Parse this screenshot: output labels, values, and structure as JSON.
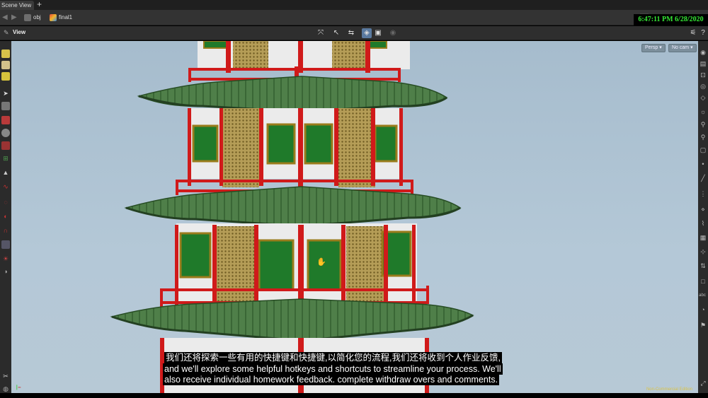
{
  "tabs": {
    "scene_view": "Scene View",
    "add": "+"
  },
  "path": {
    "obj": "obj",
    "node": "final1"
  },
  "timestamp": "6:47:11 PM 6/28/2020",
  "viewbar": {
    "label": "View"
  },
  "viewport": {
    "persp": "Persp",
    "cam": "No cam"
  },
  "subtitles": {
    "zh": "我们还将探索一些有用的快捷键和快捷键,以简化您的流程,我们还将收到个人作业反馈,",
    "en1": "and we'll explore some helpful hotkeys and shortcuts to streamline your process. We'll",
    "en2": "also receive individual homework feedback. complete withdraw overs and comments."
  },
  "watermark": "Non-Commercial Edition",
  "colors": {
    "roof": "#4e7d48",
    "pillar": "#d01a1a",
    "wall": "#eaeaea",
    "window": "#1f7a2a",
    "frame": "#9a7c1c",
    "lattice": "#b39b55",
    "time": "#34e634"
  }
}
